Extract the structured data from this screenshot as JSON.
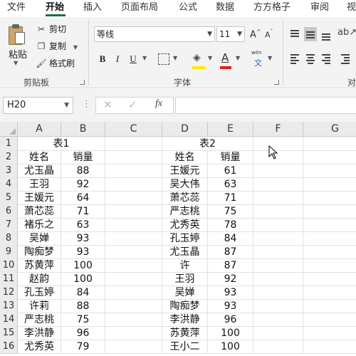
{
  "menu": {
    "tabs": [
      "文件",
      "开始",
      "插入",
      "页面布局",
      "公式",
      "数据",
      "方方格子",
      "审阅",
      "视"
    ],
    "active": "开始"
  },
  "ribbon": {
    "clipboard": {
      "paste": "粘贴",
      "cut": "剪切",
      "copy": "复制",
      "format_painter": "格式刷",
      "label": "剪贴板"
    },
    "font": {
      "name": "等线",
      "size": "11",
      "bold": "B",
      "italic": "I",
      "underline": "U",
      "grow": "A",
      "shrink": "A",
      "label": "字体",
      "fill_color": "#ffe800",
      "font_color": "#e02020",
      "phonetic": "wén"
    },
    "alignment": {
      "label": "对"
    }
  },
  "formula_bar": {
    "name_box": "H20",
    "fx": "fx",
    "formula": ""
  },
  "sheet": {
    "columns": [
      "A",
      "B",
      "C",
      "D",
      "E",
      "F",
      "G"
    ],
    "rows": [
      "1",
      "2",
      "3",
      "4",
      "5",
      "6",
      "7",
      "8",
      "9",
      "10",
      "11",
      "12",
      "13",
      "14",
      "15",
      "16"
    ],
    "table1": {
      "title": "表1",
      "headers": [
        "姓名",
        "销量"
      ],
      "data": [
        [
          "尤玉晶",
          "88"
        ],
        [
          "王羽",
          "92"
        ],
        [
          "王媛元",
          "64"
        ],
        [
          "萧芯蕊",
          "71"
        ],
        [
          "褚乐之",
          "63"
        ],
        [
          "吴婵",
          "93"
        ],
        [
          "陶痴梦",
          "93"
        ],
        [
          "苏黄萍",
          "100"
        ],
        [
          "赵韵",
          "100"
        ],
        [
          "孔玉婷",
          "84"
        ],
        [
          "许莉",
          "88"
        ],
        [
          "严志桃",
          "75"
        ],
        [
          "李洪静",
          "96"
        ],
        [
          "尤秀英",
          "79"
        ]
      ]
    },
    "table2": {
      "title": "表2",
      "headers": [
        "姓名",
        "销量"
      ],
      "data": [
        [
          "王媛元",
          "61"
        ],
        [
          "吴大伟",
          "63"
        ],
        [
          "萧芯蕊",
          "71"
        ],
        [
          "严志桃",
          "75"
        ],
        [
          "尤秀英",
          "78"
        ],
        [
          "孔玉婷",
          "84"
        ],
        [
          "尤玉晶",
          "87"
        ],
        [
          "许",
          "87"
        ],
        [
          "王羽",
          "92"
        ],
        [
          "吴婵",
          "93"
        ],
        [
          "陶痴梦",
          "93"
        ],
        [
          "李洪静",
          "96"
        ],
        [
          "苏黄萍",
          "100"
        ],
        [
          "王小二",
          "100"
        ]
      ]
    }
  }
}
